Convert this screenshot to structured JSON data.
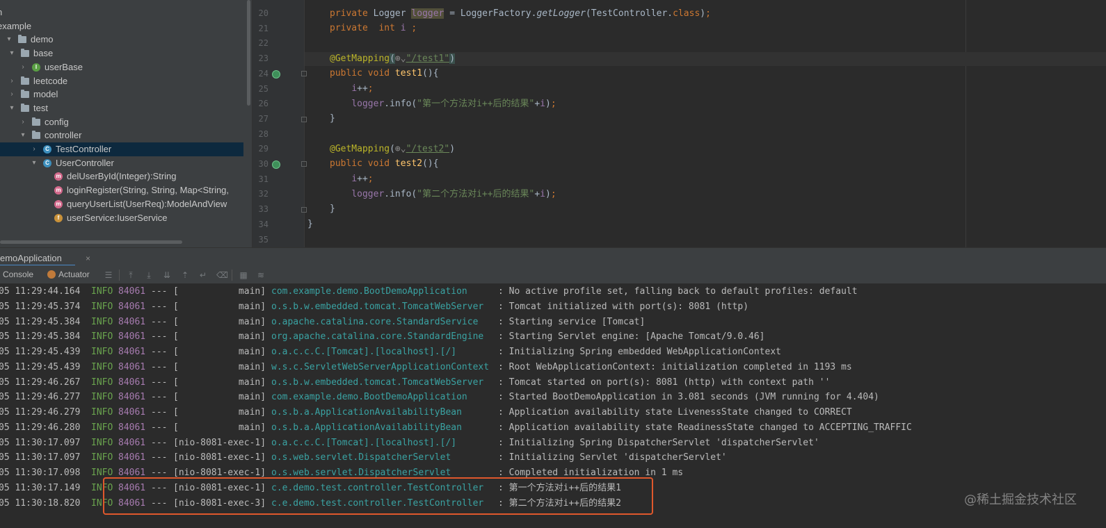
{
  "tree": {
    "items": [
      {
        "label": "n",
        "icon": "none",
        "arrow": ""
      },
      {
        "label": "example",
        "icon": "none",
        "arrow": ""
      },
      {
        "label": "demo",
        "icon": "folder-icon",
        "arrow": "▾"
      },
      {
        "label": "base",
        "icon": "folder-icon",
        "arrow": "▾"
      },
      {
        "label": "userBase",
        "icon": "interface-icon",
        "arrow": "›"
      },
      {
        "label": "leetcode",
        "icon": "folder-icon",
        "arrow": "›"
      },
      {
        "label": "model",
        "icon": "folder-icon",
        "arrow": "›"
      },
      {
        "label": "test",
        "icon": "folder-icon",
        "arrow": "▾"
      },
      {
        "label": "config",
        "icon": "folder-icon",
        "arrow": "›"
      },
      {
        "label": "controller",
        "icon": "folder-icon",
        "arrow": "▾"
      },
      {
        "label": "TestController",
        "icon": "class-icon",
        "arrow": "›"
      },
      {
        "label": "UserController",
        "icon": "class-icon",
        "arrow": "▾"
      },
      {
        "label": "delUserById(Integer):String",
        "icon": "method-icon",
        "arrow": ""
      },
      {
        "label": "loginRegister(String, String, Map<String, ",
        "icon": "method-icon",
        "arrow": ""
      },
      {
        "label": "queryUserList(UserReq):ModelAndView",
        "icon": "method-icon",
        "arrow": ""
      },
      {
        "label": "userService:IuserService",
        "icon": "field-icon",
        "arrow": ""
      }
    ]
  },
  "editor": {
    "line_numbers": [
      "20",
      "21",
      "22",
      "23",
      "24",
      "25",
      "26",
      "27",
      "28",
      "29",
      "30",
      "31",
      "32",
      "33",
      "34",
      "35"
    ]
  },
  "run": {
    "tab_label": "emoApplication",
    "close": "×",
    "console_label": "Console",
    "actuator_label": "Actuator"
  },
  "log": {
    "rows": [
      {
        "ts": "05 11:29:44.164",
        "lvl": "INFO",
        "pid": "84061",
        "sep": "---",
        "thread": "[           main]",
        "logger": "com.example.demo.BootDemoApplication",
        "msg": ": No active profile set, falling back to default profiles: default"
      },
      {
        "ts": "05 11:29:45.374",
        "lvl": "INFO",
        "pid": "84061",
        "sep": "---",
        "thread": "[           main]",
        "logger": "o.s.b.w.embedded.tomcat.TomcatWebServer",
        "msg": ": Tomcat initialized with port(s): 8081 (http)"
      },
      {
        "ts": "05 11:29:45.384",
        "lvl": "INFO",
        "pid": "84061",
        "sep": "---",
        "thread": "[           main]",
        "logger": "o.apache.catalina.core.StandardService",
        "msg": ": Starting service [Tomcat]"
      },
      {
        "ts": "05 11:29:45.384",
        "lvl": "INFO",
        "pid": "84061",
        "sep": "---",
        "thread": "[           main]",
        "logger": "org.apache.catalina.core.StandardEngine",
        "msg": ": Starting Servlet engine: [Apache Tomcat/9.0.46]"
      },
      {
        "ts": "05 11:29:45.439",
        "lvl": "INFO",
        "pid": "84061",
        "sep": "---",
        "thread": "[           main]",
        "logger": "o.a.c.c.C.[Tomcat].[localhost].[/]",
        "msg": ": Initializing Spring embedded WebApplicationContext"
      },
      {
        "ts": "05 11:29:45.439",
        "lvl": "INFO",
        "pid": "84061",
        "sep": "---",
        "thread": "[           main]",
        "logger": "w.s.c.ServletWebServerApplicationContext",
        "msg": ": Root WebApplicationContext: initialization completed in 1193 ms"
      },
      {
        "ts": "05 11:29:46.267",
        "lvl": "INFO",
        "pid": "84061",
        "sep": "---",
        "thread": "[           main]",
        "logger": "o.s.b.w.embedded.tomcat.TomcatWebServer",
        "msg": ": Tomcat started on port(s): 8081 (http) with context path ''"
      },
      {
        "ts": "05 11:29:46.277",
        "lvl": "INFO",
        "pid": "84061",
        "sep": "---",
        "thread": "[           main]",
        "logger": "com.example.demo.BootDemoApplication",
        "msg": ": Started BootDemoApplication in 3.081 seconds (JVM running for 4.404)"
      },
      {
        "ts": "05 11:29:46.279",
        "lvl": "INFO",
        "pid": "84061",
        "sep": "---",
        "thread": "[           main]",
        "logger": "o.s.b.a.ApplicationAvailabilityBean",
        "msg": ": Application availability state LivenessState changed to CORRECT"
      },
      {
        "ts": "05 11:29:46.280",
        "lvl": "INFO",
        "pid": "84061",
        "sep": "---",
        "thread": "[           main]",
        "logger": "o.s.b.a.ApplicationAvailabilityBean",
        "msg": ": Application availability state ReadinessState changed to ACCEPTING_TRAFFIC"
      },
      {
        "ts": "05 11:30:17.097",
        "lvl": "INFO",
        "pid": "84061",
        "sep": "---",
        "thread": "[nio-8081-exec-1]",
        "logger": "o.a.c.c.C.[Tomcat].[localhost].[/]",
        "msg": ": Initializing Spring DispatcherServlet 'dispatcherServlet'"
      },
      {
        "ts": "05 11:30:17.097",
        "lvl": "INFO",
        "pid": "84061",
        "sep": "---",
        "thread": "[nio-8081-exec-1]",
        "logger": "o.s.web.servlet.DispatcherServlet",
        "msg": ": Initializing Servlet 'dispatcherServlet'"
      },
      {
        "ts": "05 11:30:17.098",
        "lvl": "INFO",
        "pid": "84061",
        "sep": "---",
        "thread": "[nio-8081-exec-1]",
        "logger": "o.s.web.servlet.DispatcherServlet",
        "msg": ": Completed initialization in 1 ms"
      },
      {
        "ts": "05 11:30:17.149",
        "lvl": "INFO",
        "pid": "84061",
        "sep": "---",
        "thread": "[nio-8081-exec-1]",
        "logger": "c.e.demo.test.controller.TestController",
        "msg": ": 第一个方法对i++后的结果1"
      },
      {
        "ts": "05 11:30:18.820",
        "lvl": "INFO",
        "pid": "84061",
        "sep": "---",
        "thread": "[nio-8081-exec-3]",
        "logger": "c.e.demo.test.controller.TestController",
        "msg": ": 第二个方法对i++后的结果2"
      }
    ]
  },
  "watermark": "@稀土掘金技术社区",
  "colors": {
    "highlight_box": "#e0582c",
    "selection": "#0d293e"
  }
}
